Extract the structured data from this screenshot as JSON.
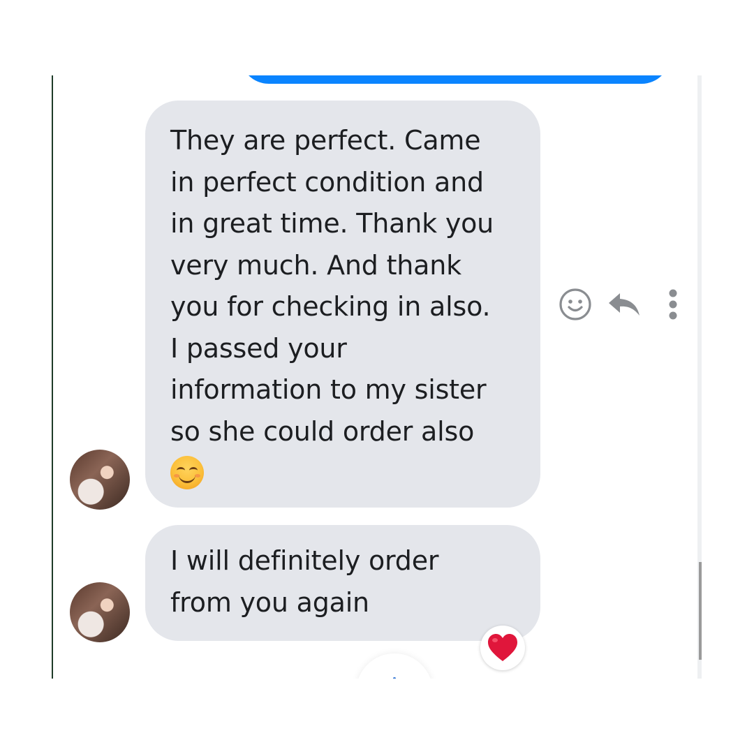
{
  "conversation": {
    "messages": [
      {
        "lines": [
          "They are perfect. Came",
          "in perfect condition and",
          "in great time. Thank you",
          "very much. And thank",
          "you for checking in also.",
          "I passed your",
          "information to my sister",
          "so she could order also"
        ],
        "emoji": "smiling-face-with-smiling-eyes"
      },
      {
        "lines": [
          "I will definitely order",
          "from you again"
        ],
        "reaction": "red-heart"
      }
    ]
  },
  "message_actions": [
    "react-icon",
    "reply-icon",
    "more-icon"
  ],
  "colors": {
    "sent_bubble": "#0a84ff",
    "received_bubble": "#e4e6eb",
    "text": "#1c1e21",
    "action_icon": "#8a8d91",
    "heart": "#e0163b"
  }
}
